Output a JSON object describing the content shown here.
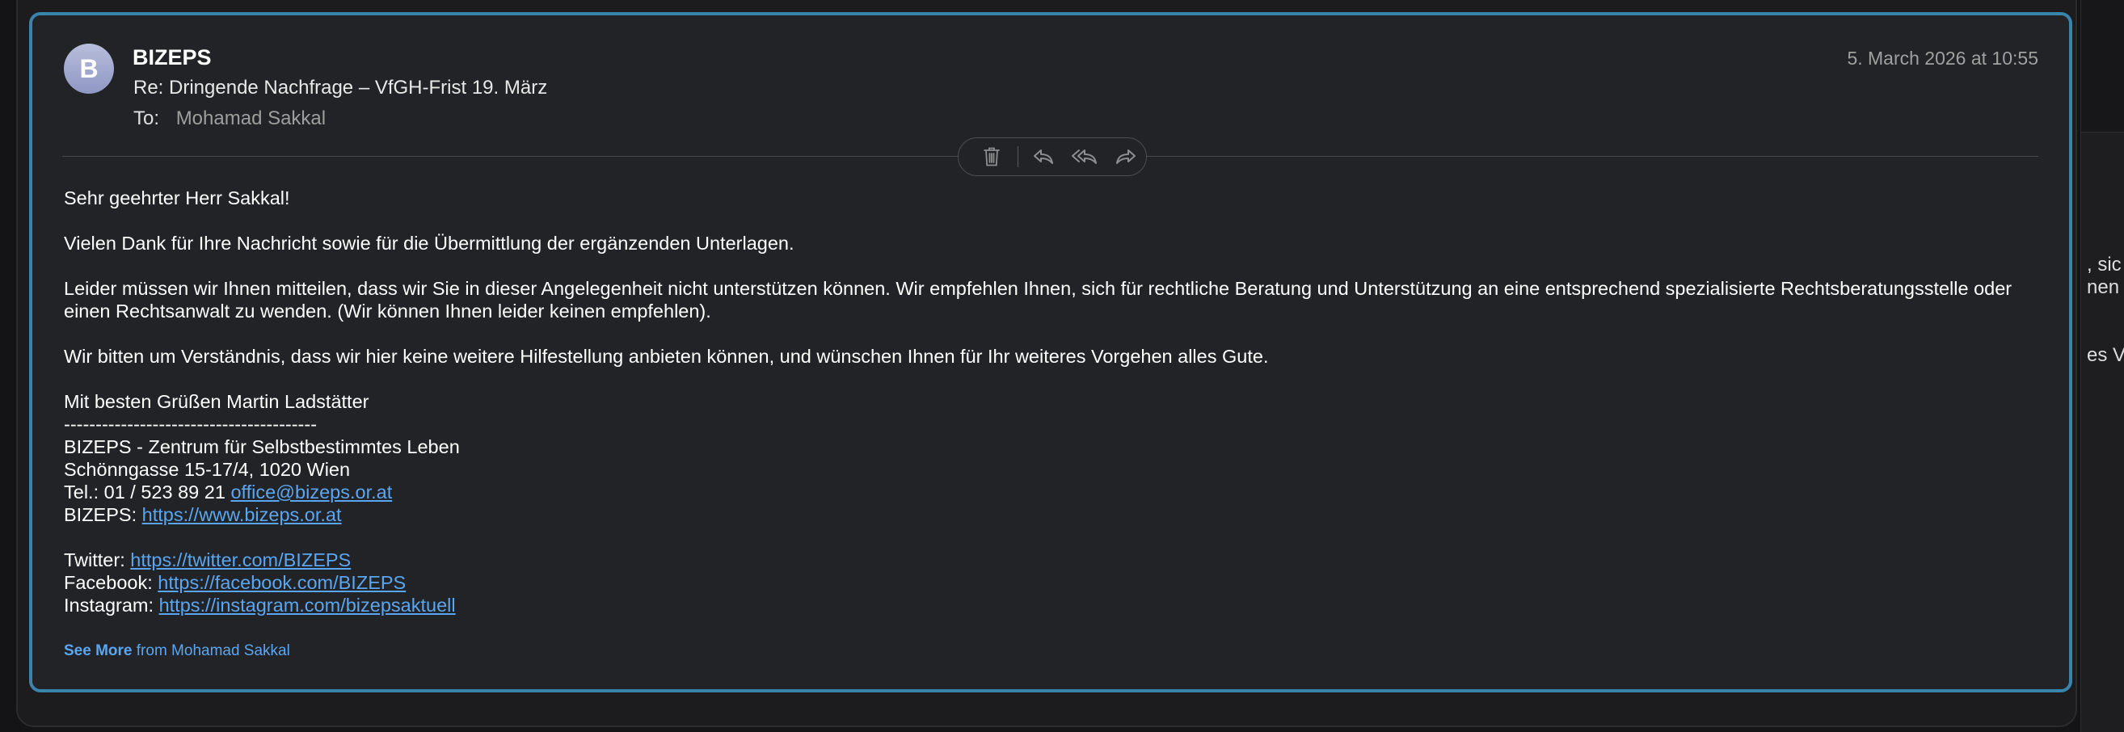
{
  "email": {
    "avatar_initial": "B",
    "sender": "BIZEPS",
    "subject": "Re: Dringende Nachfrage – VfGH-Frist 19. März",
    "to_label": "To:",
    "to_value": "Mohamad Sakkal",
    "date": "5. March 2026 at 10:55"
  },
  "toolbar": {
    "icons": [
      "trash-icon",
      "reply-icon",
      "reply-all-icon",
      "forward-icon"
    ]
  },
  "body": {
    "greeting": "Sehr geehrter Herr Sakkal!",
    "p1": "Vielen Dank für Ihre Nachricht sowie für die Übermittlung der ergänzenden Unterlagen.",
    "p2": "Leider müssen wir Ihnen mitteilen, dass wir Sie in dieser Angelegenheit nicht unterstützen können. Wir empfehlen Ihnen, sich für rechtliche Beratung und Unterstützung an eine entsprechend spezialisierte Rechtsberatungsstelle oder einen Rechtsanwalt zu wenden. (Wir können Ihnen leider keinen empfehlen).",
    "p3": "Wir bitten um Verständnis, dass wir hier keine weitere Hilfestellung anbieten können, und wünschen Ihnen für Ihr weiteres Vorgehen alles Gute.",
    "closing": "Mit besten Grüßen Martin Ladstätter",
    "separator": "----------------------------------------",
    "org": "BIZEPS - Zentrum für Selbstbestimmtes Leben",
    "address": "Schönngasse 15-17/4, 1020 Wien",
    "tel_label": "Tel.: 01 / 523 89 21",
    "email_link": "office@bizeps.or.at",
    "web_label": "BIZEPS:",
    "web_link": "https://www.bizeps.or.at",
    "twitter_label": "Twitter:",
    "twitter_link": "https://twitter.com/BIZEPS",
    "facebook_label": "Facebook:",
    "facebook_link": "https://facebook.com/BIZEPS",
    "instagram_label": "Instagram:",
    "instagram_link": "https://instagram.com/bizepsaktuell"
  },
  "see_more": {
    "bold": "See More",
    "rest": "from Mohamad Sakkal"
  },
  "background_peek": {
    "line1": ", sic",
    "line2": "nen",
    "line3": "es Vo"
  },
  "colors": {
    "accent_border": "#3a84ac",
    "link": "#5aa6f2",
    "card_bg": "#222326"
  }
}
